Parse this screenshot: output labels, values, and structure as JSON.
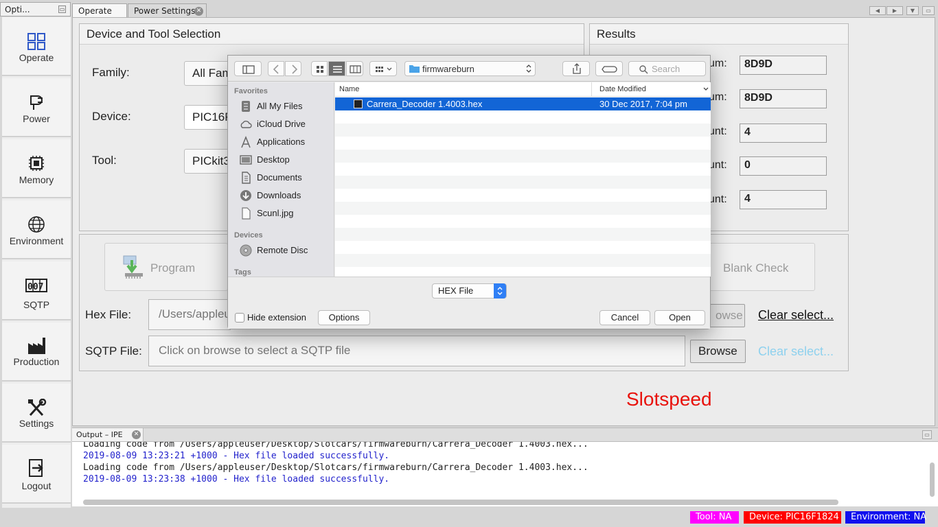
{
  "left_panel": {
    "tab_label": "Opti...",
    "items": [
      {
        "label": "Operate"
      },
      {
        "label": "Power"
      },
      {
        "label": "Memory"
      },
      {
        "label": "Environment"
      },
      {
        "label": "SQTP"
      },
      {
        "label": "Production"
      },
      {
        "label": "Settings"
      },
      {
        "label": "Logout"
      }
    ]
  },
  "tabs": [
    {
      "label": "Operate"
    },
    {
      "label": "Power Settings"
    }
  ],
  "device_tool": {
    "title": "Device and Tool Selection",
    "family_label": "Family:",
    "family_value": "All Fam",
    "device_label": "Device:",
    "device_value": "PIC16F",
    "tool_label": "Tool:",
    "tool_value": "PICkit3"
  },
  "results": {
    "title": "Results",
    "rows": [
      {
        "label": "um:",
        "value": "8D9D"
      },
      {
        "label": "um:",
        "value": "8D9D"
      },
      {
        "label": "unt:",
        "value": "4"
      },
      {
        "label": "unt:",
        "value": "0"
      },
      {
        "label": "unt:",
        "value": "4"
      }
    ]
  },
  "actions": {
    "program_label": "Program",
    "blank_check_label": "Blank Check",
    "hex_file_label": "Hex File:",
    "hex_file_value": "/Users/appleu",
    "hex_browse_partial": "owse",
    "hex_clear_label": "Clear select...",
    "sqtp_file_label": "SQTP File:",
    "sqtp_placeholder": "Click on browse to select a SQTP file",
    "sqtp_browse_label": "Browse",
    "sqtp_clear_label": "Clear select..."
  },
  "overlay_text": "Slotspeed",
  "output": {
    "tab_label": "Output – IPE",
    "lines": [
      {
        "text": "Loading code from /Users/appleuser/Desktop/Slotcars/firmwareburn/Carrera_Decoder 1.4003.hex...",
        "color": "black"
      },
      {
        "text": "2019-08-09 13:23:21 +1000 - Hex file loaded successfully.",
        "color": "blue"
      },
      {
        "text": "Loading code from /Users/appleuser/Desktop/Slotcars/firmwareburn/Carrera_Decoder 1.4003.hex...",
        "color": "black"
      },
      {
        "text": "2019-08-09 13:23:38 +1000 - Hex file loaded successfully.",
        "color": "blue"
      }
    ]
  },
  "status_bar": {
    "tool": "Tool: NA",
    "device": "Device: PIC16F1824",
    "environment": "Environment: NA",
    "colors": {
      "tool": "#ff00ff",
      "device": "#ff0000",
      "environment": "#1010ee"
    }
  },
  "dialog": {
    "path": "firmwareburn",
    "search_placeholder": "Search",
    "favorites_header": "Favorites",
    "favorites": [
      {
        "label": "All My Files",
        "icon": "all-files-icon"
      },
      {
        "label": "iCloud Drive",
        "icon": "cloud-icon"
      },
      {
        "label": "Applications",
        "icon": "applications-icon"
      },
      {
        "label": "Desktop",
        "icon": "desktop-icon"
      },
      {
        "label": "Documents",
        "icon": "documents-icon"
      },
      {
        "label": "Downloads",
        "icon": "downloads-icon"
      },
      {
        "label": "Scunl.jpg",
        "icon": "file-icon"
      }
    ],
    "devices_header": "Devices",
    "devices": [
      {
        "label": "Remote Disc",
        "icon": "disc-icon"
      }
    ],
    "tags_header": "Tags",
    "columns": {
      "name": "Name",
      "date": "Date Modified"
    },
    "files": [
      {
        "name": "Carrera_Decoder 1.4003.hex",
        "date": "30 Dec 2017, 7:04 pm",
        "selected": true
      }
    ],
    "file_type": "HEX File",
    "hide_extension_label": "Hide extension",
    "options_label": "Options",
    "cancel_label": "Cancel",
    "open_label": "Open"
  }
}
